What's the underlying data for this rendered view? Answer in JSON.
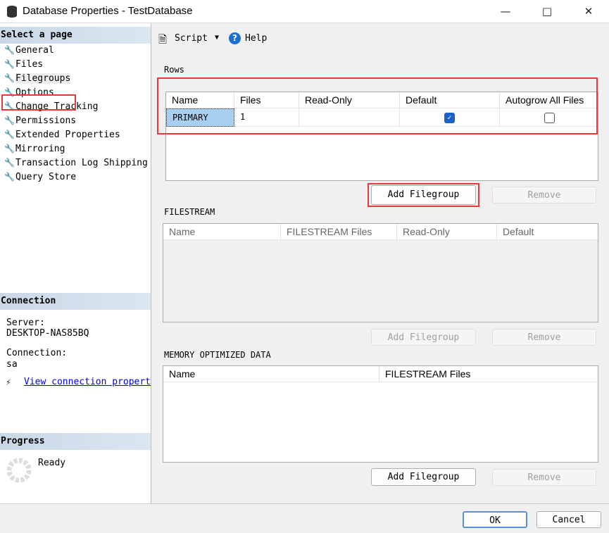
{
  "window": {
    "title": "Database Properties - TestDatabase",
    "icon": "database-icon"
  },
  "sidebar": {
    "header": "Select a page",
    "items": [
      {
        "label": "General"
      },
      {
        "label": "Files"
      },
      {
        "label": "Filegroups",
        "selected": true
      },
      {
        "label": "Options"
      },
      {
        "label": "Change Tracking"
      },
      {
        "label": "Permissions"
      },
      {
        "label": "Extended Properties"
      },
      {
        "label": "Mirroring"
      },
      {
        "label": "Transaction Log Shipping"
      },
      {
        "label": "Query Store"
      }
    ]
  },
  "connection": {
    "header": "Connection",
    "server_label": "Server:",
    "server": "DESKTOP-NAS85BQ",
    "connection_label": "Connection:",
    "connection": "sa",
    "link": "View connection properties"
  },
  "progress": {
    "header": "Progress",
    "status": "Ready"
  },
  "toolbar": {
    "script": "Script",
    "help": "Help"
  },
  "rows": {
    "label": "Rows",
    "columns": [
      "Name",
      "Files",
      "Read-Only",
      "Default",
      "Autogrow All Files"
    ],
    "data": [
      {
        "name": "PRIMARY",
        "files": "1",
        "read_only": false,
        "default": true,
        "autogrow": false
      }
    ],
    "add": "Add Filegroup",
    "remove": "Remove"
  },
  "filestream": {
    "label": "FILESTREAM",
    "columns": [
      "Name",
      "FILESTREAM Files",
      "Read-Only",
      "Default"
    ],
    "add": "Add Filegroup",
    "remove": "Remove"
  },
  "memory": {
    "label": "MEMORY OPTIMIZED DATA",
    "columns": [
      "Name",
      "FILESTREAM Files"
    ],
    "add": "Add Filegroup",
    "remove": "Remove"
  },
  "footer": {
    "ok": "OK",
    "cancel": "Cancel"
  },
  "colors": {
    "highlight": "#e8393b",
    "selection": "#a8cff0",
    "checkbox": "#1a62c5",
    "link": "#0000ee"
  }
}
